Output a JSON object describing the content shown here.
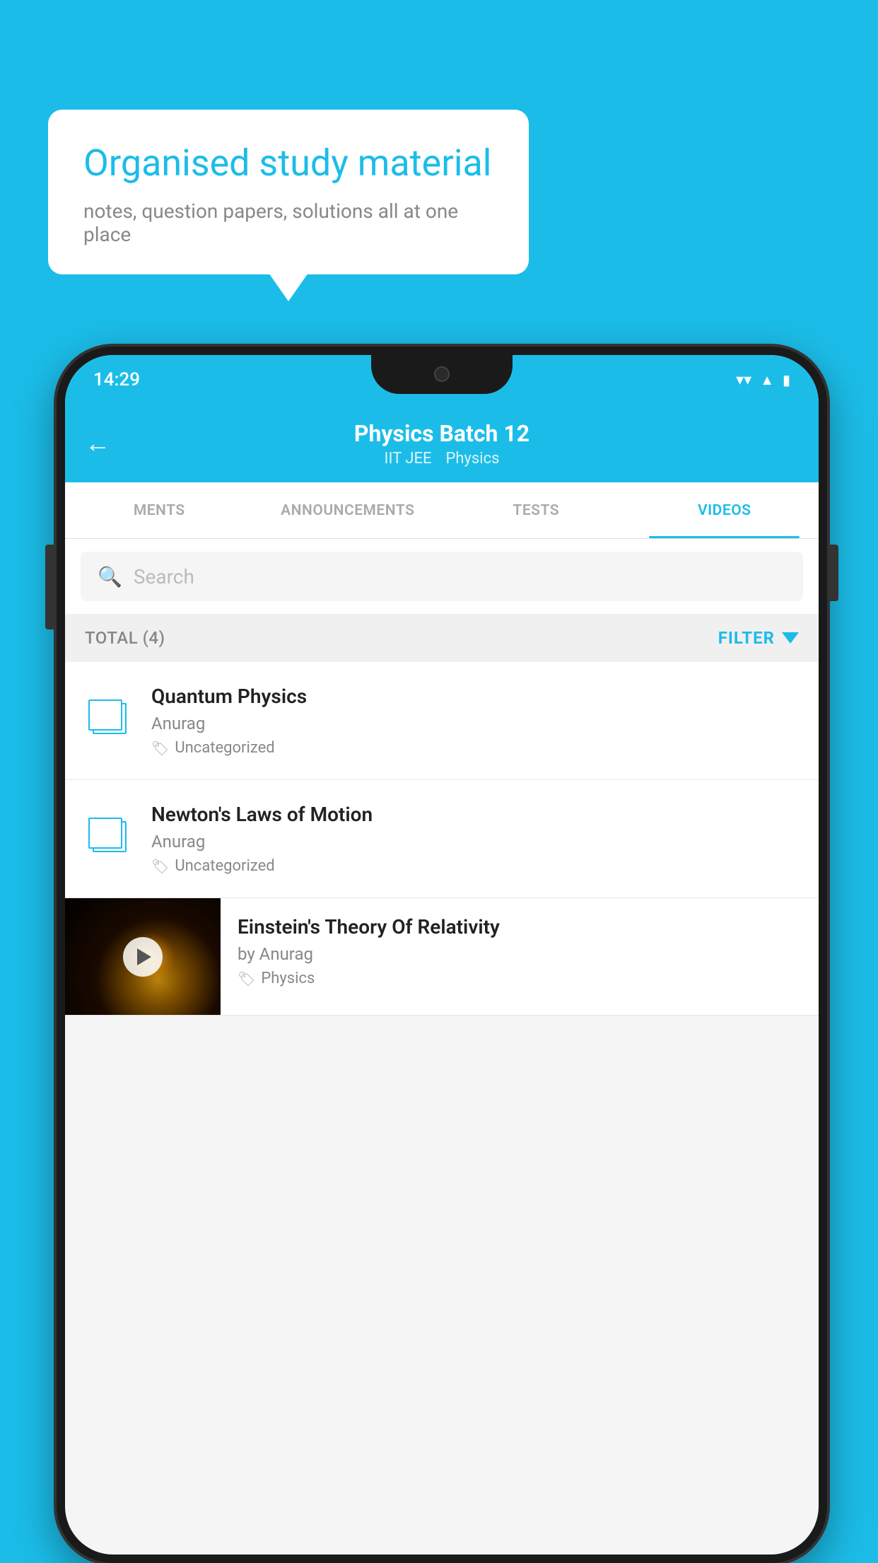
{
  "background_color": "#1BBDE8",
  "bubble": {
    "title": "Organised study material",
    "subtitle": "notes, question papers, solutions all at one place"
  },
  "status_bar": {
    "time": "14:29",
    "icons": [
      "wifi",
      "signal",
      "battery"
    ]
  },
  "app_header": {
    "back_label": "←",
    "title": "Physics Batch 12",
    "subtitle_parts": [
      "IIT JEE",
      "Physics"
    ]
  },
  "tabs": [
    {
      "label": "MENTS",
      "active": false
    },
    {
      "label": "ANNOUNCEMENTS",
      "active": false
    },
    {
      "label": "TESTS",
      "active": false
    },
    {
      "label": "VIDEOS",
      "active": true
    }
  ],
  "search": {
    "placeholder": "Search"
  },
  "filter_bar": {
    "total_label": "TOTAL (4)",
    "filter_label": "FILTER"
  },
  "videos": [
    {
      "title": "Quantum Physics",
      "author": "Anurag",
      "tag": "Uncategorized",
      "has_thumb": false
    },
    {
      "title": "Newton's Laws of Motion",
      "author": "Anurag",
      "tag": "Uncategorized",
      "has_thumb": false
    },
    {
      "title": "Einstein's Theory Of Relativity",
      "author": "by Anurag",
      "tag": "Physics",
      "has_thumb": true
    }
  ]
}
